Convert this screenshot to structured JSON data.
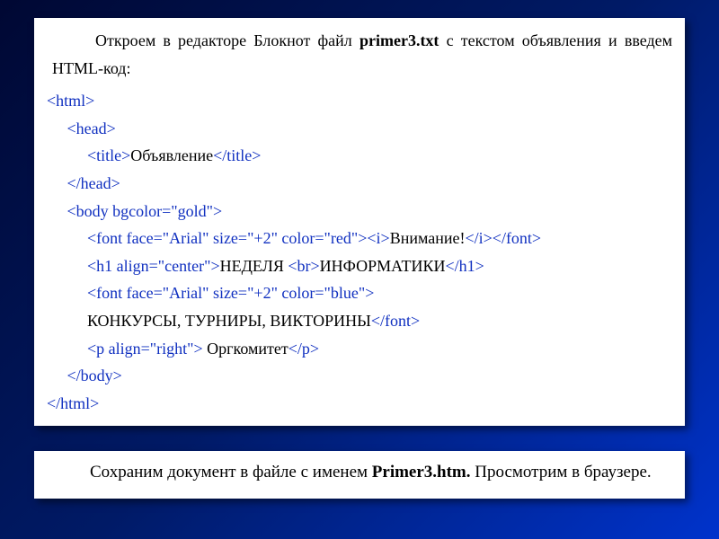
{
  "intro": {
    "part1": "Откроем в редакторе Блокнот файл ",
    "filename": "primer3.txt",
    "part2": " с текстом объявления и введем HTML-код:"
  },
  "lines": [
    {
      "ind": 0,
      "segs": [
        {
          "c": "tag",
          "t": "<html>"
        }
      ]
    },
    {
      "ind": 1,
      "segs": [
        {
          "c": "tag",
          "t": "<head>"
        }
      ]
    },
    {
      "ind": 2,
      "segs": [
        {
          "c": "tag",
          "t": "<title>"
        },
        {
          "c": "txt",
          "t": "Объявление"
        },
        {
          "c": "tag",
          "t": "</title>"
        }
      ]
    },
    {
      "ind": 1,
      "segs": [
        {
          "c": "tag",
          "t": "</head>"
        }
      ]
    },
    {
      "ind": 1,
      "segs": [
        {
          "c": "tag",
          "t": "<body bgcolor=\"gold\">"
        }
      ]
    },
    {
      "ind": 2,
      "segs": [
        {
          "c": "tag",
          "t": "<font face=\"Arial\" size=\"+2\" color=\"red\"><i>"
        },
        {
          "c": "txt",
          "t": "Внимание!"
        },
        {
          "c": "tag",
          "t": "</i></font>"
        }
      ]
    },
    {
      "ind": 2,
      "segs": [
        {
          "c": "tag",
          "t": "<h1 align=\"center\">"
        },
        {
          "c": "txt",
          "t": "НЕДЕЛЯ "
        },
        {
          "c": "tag",
          "t": "<br>"
        },
        {
          "c": "txt",
          "t": "ИНФОРМАТИКИ"
        },
        {
          "c": "tag",
          "t": "</h1>"
        }
      ]
    },
    {
      "ind": 2,
      "segs": [
        {
          "c": "tag",
          "t": "<font face=\"Arial\" size=\"+2\" color=\"blue\">"
        }
      ]
    },
    {
      "ind": 2,
      "segs": [
        {
          "c": "txt",
          "t": "КОНКУРСЫ, ТУРНИРЫ, ВИКТОРИНЫ"
        },
        {
          "c": "tag",
          "t": "</font>"
        }
      ]
    },
    {
      "ind": 2,
      "segs": [
        {
          "c": "tag",
          "t": "<p align=\"right\">"
        },
        {
          "c": "txt",
          "t": " Оргкомитет"
        },
        {
          "c": "tag",
          "t": "</p>"
        }
      ]
    },
    {
      "ind": 1,
      "segs": [
        {
          "c": "tag",
          "t": "</body>"
        }
      ]
    },
    {
      "ind": 0,
      "segs": [
        {
          "c": "tag",
          "t": "</html>"
        }
      ]
    }
  ],
  "footer": {
    "part1": "Сохраним документ в файле с именем ",
    "filename": "Primer3.htm.",
    "part2": " Просмотрим в браузере."
  }
}
